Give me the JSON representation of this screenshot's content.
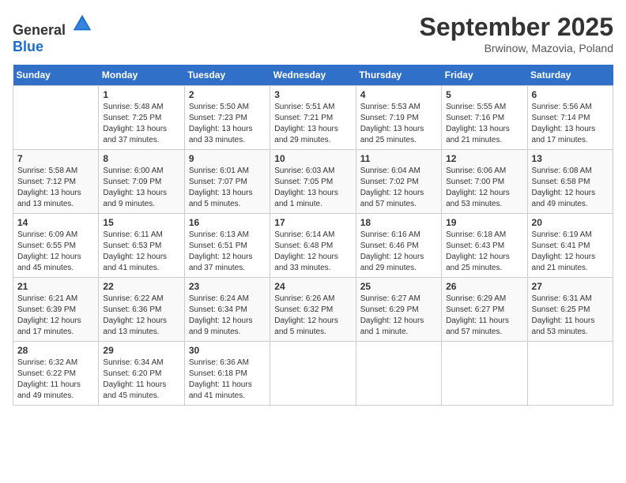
{
  "header": {
    "logo_general": "General",
    "logo_blue": "Blue",
    "month": "September 2025",
    "location": "Brwinow, Mazovia, Poland"
  },
  "days_of_week": [
    "Sunday",
    "Monday",
    "Tuesday",
    "Wednesday",
    "Thursday",
    "Friday",
    "Saturday"
  ],
  "weeks": [
    [
      {
        "day": "",
        "info": ""
      },
      {
        "day": "1",
        "info": "Sunrise: 5:48 AM\nSunset: 7:25 PM\nDaylight: 13 hours\nand 37 minutes."
      },
      {
        "day": "2",
        "info": "Sunrise: 5:50 AM\nSunset: 7:23 PM\nDaylight: 13 hours\nand 33 minutes."
      },
      {
        "day": "3",
        "info": "Sunrise: 5:51 AM\nSunset: 7:21 PM\nDaylight: 13 hours\nand 29 minutes."
      },
      {
        "day": "4",
        "info": "Sunrise: 5:53 AM\nSunset: 7:19 PM\nDaylight: 13 hours\nand 25 minutes."
      },
      {
        "day": "5",
        "info": "Sunrise: 5:55 AM\nSunset: 7:16 PM\nDaylight: 13 hours\nand 21 minutes."
      },
      {
        "day": "6",
        "info": "Sunrise: 5:56 AM\nSunset: 7:14 PM\nDaylight: 13 hours\nand 17 minutes."
      }
    ],
    [
      {
        "day": "7",
        "info": "Sunrise: 5:58 AM\nSunset: 7:12 PM\nDaylight: 13 hours\nand 13 minutes."
      },
      {
        "day": "8",
        "info": "Sunrise: 6:00 AM\nSunset: 7:09 PM\nDaylight: 13 hours\nand 9 minutes."
      },
      {
        "day": "9",
        "info": "Sunrise: 6:01 AM\nSunset: 7:07 PM\nDaylight: 13 hours\nand 5 minutes."
      },
      {
        "day": "10",
        "info": "Sunrise: 6:03 AM\nSunset: 7:05 PM\nDaylight: 13 hours\nand 1 minute."
      },
      {
        "day": "11",
        "info": "Sunrise: 6:04 AM\nSunset: 7:02 PM\nDaylight: 12 hours\nand 57 minutes."
      },
      {
        "day": "12",
        "info": "Sunrise: 6:06 AM\nSunset: 7:00 PM\nDaylight: 12 hours\nand 53 minutes."
      },
      {
        "day": "13",
        "info": "Sunrise: 6:08 AM\nSunset: 6:58 PM\nDaylight: 12 hours\nand 49 minutes."
      }
    ],
    [
      {
        "day": "14",
        "info": "Sunrise: 6:09 AM\nSunset: 6:55 PM\nDaylight: 12 hours\nand 45 minutes."
      },
      {
        "day": "15",
        "info": "Sunrise: 6:11 AM\nSunset: 6:53 PM\nDaylight: 12 hours\nand 41 minutes."
      },
      {
        "day": "16",
        "info": "Sunrise: 6:13 AM\nSunset: 6:51 PM\nDaylight: 12 hours\nand 37 minutes."
      },
      {
        "day": "17",
        "info": "Sunrise: 6:14 AM\nSunset: 6:48 PM\nDaylight: 12 hours\nand 33 minutes."
      },
      {
        "day": "18",
        "info": "Sunrise: 6:16 AM\nSunset: 6:46 PM\nDaylight: 12 hours\nand 29 minutes."
      },
      {
        "day": "19",
        "info": "Sunrise: 6:18 AM\nSunset: 6:43 PM\nDaylight: 12 hours\nand 25 minutes."
      },
      {
        "day": "20",
        "info": "Sunrise: 6:19 AM\nSunset: 6:41 PM\nDaylight: 12 hours\nand 21 minutes."
      }
    ],
    [
      {
        "day": "21",
        "info": "Sunrise: 6:21 AM\nSunset: 6:39 PM\nDaylight: 12 hours\nand 17 minutes."
      },
      {
        "day": "22",
        "info": "Sunrise: 6:22 AM\nSunset: 6:36 PM\nDaylight: 12 hours\nand 13 minutes."
      },
      {
        "day": "23",
        "info": "Sunrise: 6:24 AM\nSunset: 6:34 PM\nDaylight: 12 hours\nand 9 minutes."
      },
      {
        "day": "24",
        "info": "Sunrise: 6:26 AM\nSunset: 6:32 PM\nDaylight: 12 hours\nand 5 minutes."
      },
      {
        "day": "25",
        "info": "Sunrise: 6:27 AM\nSunset: 6:29 PM\nDaylight: 12 hours\nand 1 minute."
      },
      {
        "day": "26",
        "info": "Sunrise: 6:29 AM\nSunset: 6:27 PM\nDaylight: 11 hours\nand 57 minutes."
      },
      {
        "day": "27",
        "info": "Sunrise: 6:31 AM\nSunset: 6:25 PM\nDaylight: 11 hours\nand 53 minutes."
      }
    ],
    [
      {
        "day": "28",
        "info": "Sunrise: 6:32 AM\nSunset: 6:22 PM\nDaylight: 11 hours\nand 49 minutes."
      },
      {
        "day": "29",
        "info": "Sunrise: 6:34 AM\nSunset: 6:20 PM\nDaylight: 11 hours\nand 45 minutes."
      },
      {
        "day": "30",
        "info": "Sunrise: 6:36 AM\nSunset: 6:18 PM\nDaylight: 11 hours\nand 41 minutes."
      },
      {
        "day": "",
        "info": ""
      },
      {
        "day": "",
        "info": ""
      },
      {
        "day": "",
        "info": ""
      },
      {
        "day": "",
        "info": ""
      }
    ]
  ]
}
